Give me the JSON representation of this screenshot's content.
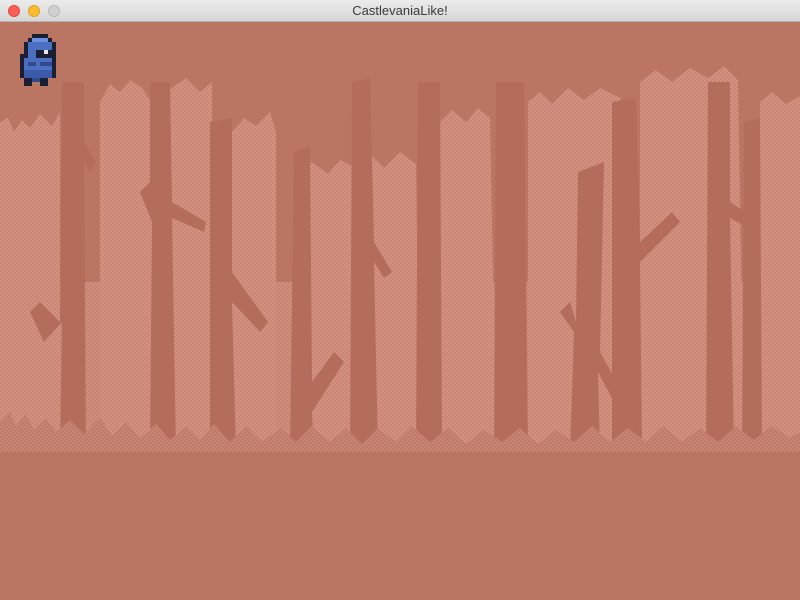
{
  "window": {
    "title": "CastlevaniaLike!"
  },
  "colors": {
    "background": "#bb7563",
    "far_trees": "#d08d7d",
    "mid_trees": "#c4806f",
    "near_trees": "#b46d5b",
    "ground": "#bb7563",
    "player_body": "#4d6fc2",
    "player_outline": "#1b1f33"
  },
  "icons": {
    "close": "close-button-icon",
    "minimize": "minimize-button-icon",
    "maximize": "maximize-button-icon",
    "player": "hooded-knight-sprite"
  }
}
